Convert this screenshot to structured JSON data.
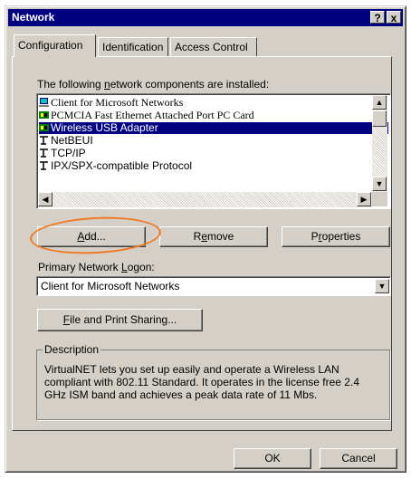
{
  "window": {
    "title": "Network",
    "help_button": "?",
    "close_button": "x"
  },
  "tabs": [
    {
      "label": "Configuration",
      "active": true
    },
    {
      "label": "Identification",
      "active": false
    },
    {
      "label": "Access Control",
      "active": false
    }
  ],
  "components": {
    "label": "The following network components are installed:",
    "items": [
      {
        "label": "Client for Microsoft Networks",
        "icon": "client-icon",
        "selected": false
      },
      {
        "label": "PCMCIA Fast Ethernet Attached Port PC Card",
        "icon": "adapter-icon",
        "selected": false
      },
      {
        "label": "Wireless USB Adapter",
        "icon": "adapter-icon",
        "selected": true
      },
      {
        "label": "NetBEUI",
        "icon": "protocol-icon",
        "selected": false
      },
      {
        "label": "TCP/IP",
        "icon": "protocol-icon",
        "selected": false
      },
      {
        "label": "IPX/SPX-compatible Protocol",
        "icon": "protocol-icon",
        "selected": false
      }
    ]
  },
  "buttons": {
    "add": "Add...",
    "remove": "Remove",
    "properties": "Properties"
  },
  "logon": {
    "label": "Primary Network Logon:",
    "value": "Client for Microsoft Networks"
  },
  "file_print_sharing": "File and Print Sharing...",
  "description": {
    "title": "Description",
    "text": "VirtualNET lets you set up easily and operate a Wireless LAN compliant with 802.11 Standard. It operates in the license free 2.4 GHz ISM band and achieves a peak data rate of 11 Mbs."
  },
  "footer": {
    "ok": "OK",
    "cancel": "Cancel"
  },
  "colors": {
    "titlebar": "#000080",
    "face": "#d4d0c8",
    "selection": "#000080",
    "highlight_oval": "#f07a24"
  }
}
